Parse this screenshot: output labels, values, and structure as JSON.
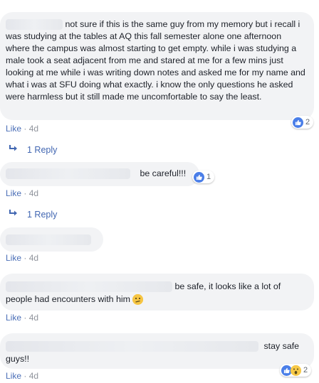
{
  "comments": [
    {
      "text": "not sure if this is the same guy from my memory but i recall i was studying at the tables at AQ this fall semester alone one afternoon where the campus was almost starting to get empty. while i was studying a male took a seat adjacent from me and stared at me for a few mins just looking at me while i was writing down notes and asked me for my name and what i was at SFU doing what exactly. i know the only questions he asked were harmless but it still made me uncomfortable to say the least.",
      "like_label": "Like",
      "sep": " · ",
      "time": "4d",
      "reaction_count": "2",
      "reply_label": "1 Reply"
    },
    {
      "text": "be careful!!!",
      "like_label": "Like",
      "sep": " · ",
      "time": "4d",
      "reaction_count": "1",
      "reply_label": "1 Reply"
    },
    {
      "text": "",
      "like_label": "Like",
      "sep": " · ",
      "time": "4d"
    },
    {
      "text": "be safe, it looks like a lot of people had encounters with him",
      "emoji": "confused-face",
      "like_label": "Like",
      "sep": " · ",
      "time": "4d"
    },
    {
      "text": "stay safe guys!!",
      "like_label": "Like",
      "sep": " · ",
      "time": "4d",
      "reaction_count": "2"
    }
  ],
  "colors": {
    "bubble": "#f2f3f5",
    "link": "#4267b2",
    "meta": "#90949c",
    "like_reaction": "#4a7ee8"
  },
  "icons": [
    "thumbs-up-icon",
    "wow-icon",
    "reply-arrow-icon",
    "confused-face-icon"
  ]
}
